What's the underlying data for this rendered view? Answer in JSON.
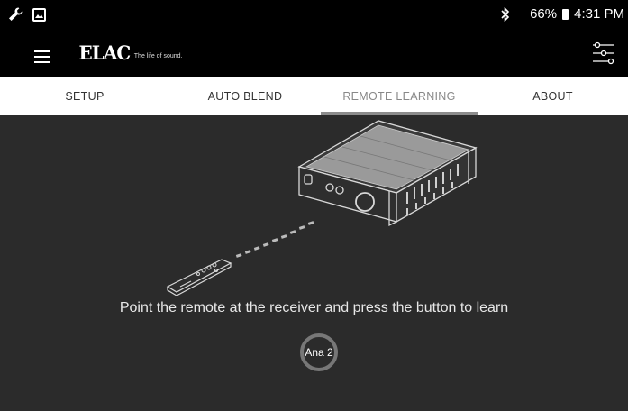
{
  "status_bar": {
    "battery": "66%",
    "time": "4:31 PM"
  },
  "app_bar": {
    "logo": "ELAC",
    "tagline": "The life of sound."
  },
  "tabs": [
    {
      "label": "SETUP",
      "active": false
    },
    {
      "label": "AUTO BLEND",
      "active": false
    },
    {
      "label": "REMOTE LEARNING",
      "active": true
    },
    {
      "label": "ABOUT",
      "active": false
    }
  ],
  "main": {
    "instruction": "Point the remote at the receiver and press the button to learn",
    "learn_button_label": "Ana 2"
  },
  "colors": {
    "background": "#2b2b2b",
    "bar": "#000000",
    "tab_bar": "#ffffff",
    "active_underline": "#8c8c8c"
  }
}
